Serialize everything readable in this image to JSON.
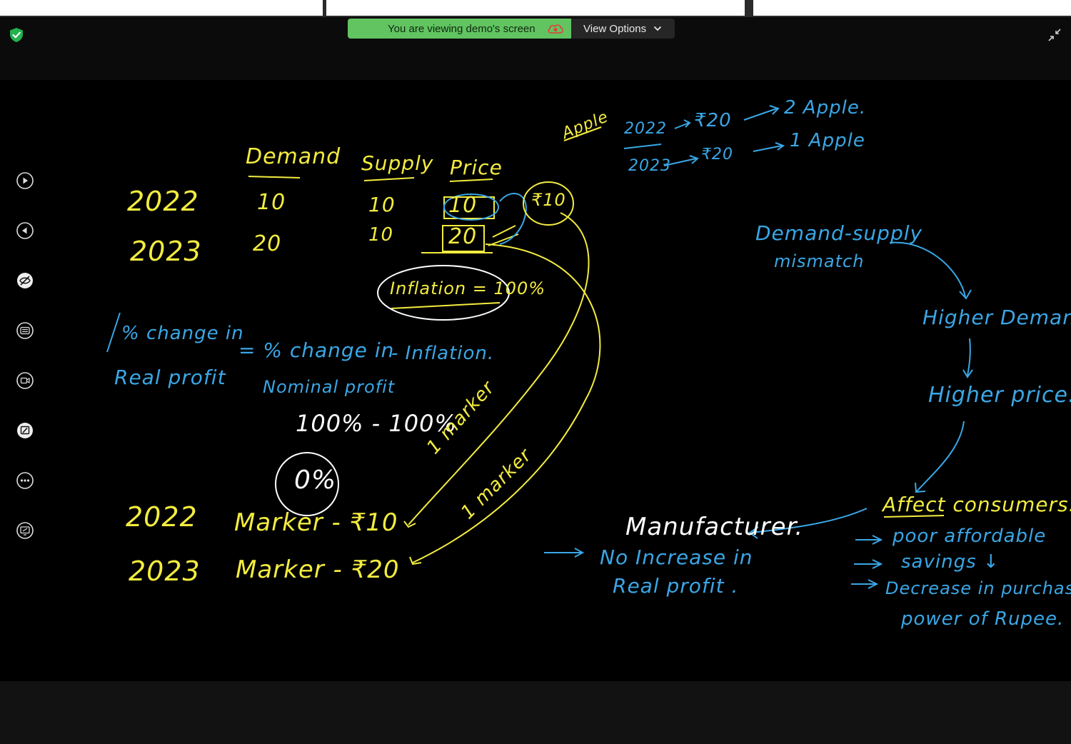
{
  "banner": {
    "viewing_text": "You are viewing demo's screen",
    "view_options_label": "View Options"
  },
  "colors": {
    "yellow_ink": "#f3ec3f",
    "blue_ink": "#3aa7e6",
    "white_ink": "#ffffff",
    "banner_green": "#61c461"
  },
  "toolbar": {
    "icons": [
      "play-icon",
      "back-icon",
      "hide-annotations-icon",
      "captions-icon",
      "record-icon",
      "whiteboard-icon",
      "more-icon",
      "share-screen-icon"
    ]
  },
  "whiteboard": {
    "headers": {
      "demand": "Demand",
      "supply": "Supply",
      "price": "Price"
    },
    "rows": [
      {
        "year": "2022",
        "demand": "10",
        "supply": "10",
        "price": "10"
      },
      {
        "year": "2023",
        "demand": "20",
        "supply": "10",
        "price": "20"
      }
    ],
    "circle_note": "₹10",
    "inflation": "Inflation = 100%",
    "apple_label": "Apple",
    "apple_rows": [
      {
        "year": "2022",
        "price": "₹20",
        "result": "2 Apple."
      },
      {
        "year": "2023",
        "price": "₹20",
        "result": "1 Apple"
      }
    ],
    "formula_lhs_1": "% change in",
    "formula_lhs_2": "Real profit",
    "formula_rhs_1": "= % change in",
    "formula_rhs_2": "Nominal profit",
    "formula_rhs_3": "- Inflation.",
    "calc": "100% - 100%",
    "result": "0%",
    "marker_rows": [
      {
        "year": "2022",
        "text": "Marker - ₹10"
      },
      {
        "year": "2023",
        "text": "Marker - ₹20"
      }
    ],
    "marker_note_1": "1 marker",
    "marker_note_2": "1 marker",
    "flow": {
      "mismatch_1": "Demand-supply",
      "mismatch_2": "mismatch",
      "higher_demand": "Higher Demand",
      "higher_price": "Higher price.",
      "affect": "Affect consumers.",
      "effects": [
        "poor affordable",
        "savings ↓",
        "Decrease in purchasing",
        "power of Rupee."
      ]
    },
    "manufacturer": "Manufacturer.",
    "no_increase_1": "No Increase in",
    "no_increase_2": "Real profit ."
  }
}
